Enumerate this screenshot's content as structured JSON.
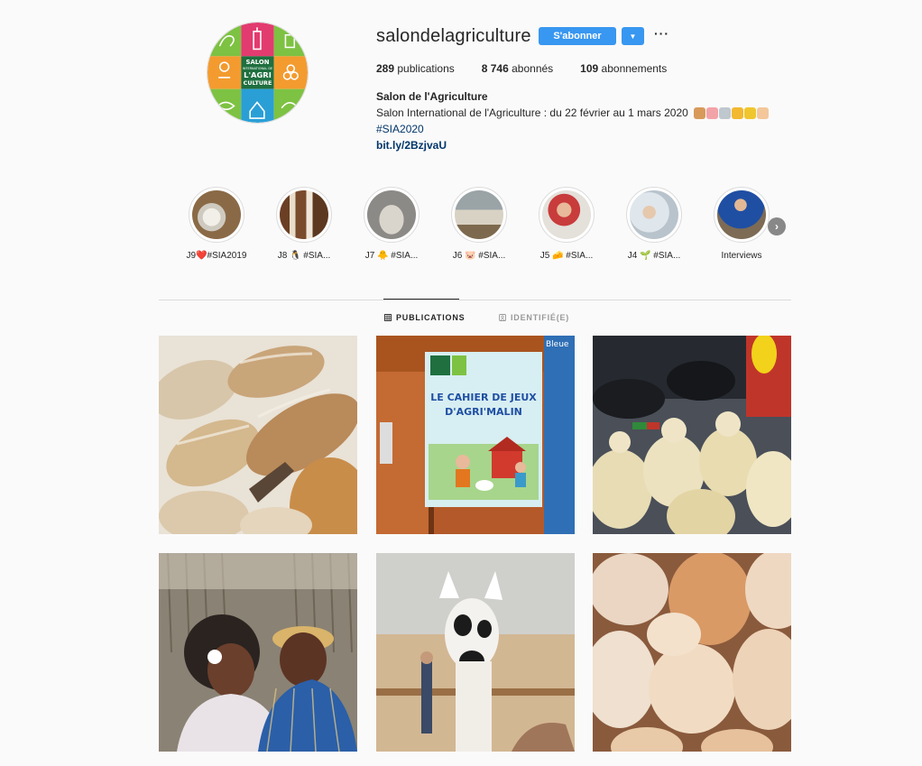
{
  "profile": {
    "username": "salondelagriculture",
    "follow_label": "S'abonner",
    "more_icon": "more-horizontal-icon",
    "stats": {
      "posts": "289",
      "posts_label": "publications",
      "followers": "8 746",
      "followers_label": "abonnés",
      "following": "109",
      "following_label": "abonnements"
    },
    "bio": {
      "name": "Salon de l'Agriculture",
      "line": "Salon International de l'Agriculture : du 22 février au 1 mars 2020",
      "hashtag": "#SIA2020",
      "link": "bit.ly/2BzjvaU"
    },
    "logo_text": [
      "SALON",
      "INTERNATIONAL DE",
      "L'AGRI",
      "CULTURE"
    ]
  },
  "highlights": [
    {
      "label": "J9❤️#SIA2019"
    },
    {
      "label": "J8 🐧 #SIA..."
    },
    {
      "label": "J7 🐥 #SIA..."
    },
    {
      "label": "J6 🐷 #SIA..."
    },
    {
      "label": "J5 🧀 #SIA..."
    },
    {
      "label": "J4 🌱 #SIA..."
    },
    {
      "label": "Interviews"
    }
  ],
  "tabs": [
    {
      "label": "PUBLICATIONS",
      "icon": "grid-icon",
      "active": true
    },
    {
      "label": "IDENTIFIÉ(E)",
      "icon": "tagged-icon",
      "active": false
    }
  ],
  "posts_grid": {
    "rows": 2,
    "columns": 3,
    "posts": [
      {
        "subject": "bread-loaves"
      },
      {
        "subject": "game-booklet",
        "printed_text": [
          "LE CAHIER DE JEUX",
          "D'AGRI'MALIN",
          "Bleue"
        ]
      },
      {
        "subject": "cheeses"
      },
      {
        "subject": "women-smiling"
      },
      {
        "subject": "llama"
      },
      {
        "subject": "eggs"
      }
    ]
  },
  "colors": {
    "follow_button": "#3897f0",
    "link_text": "#003569",
    "background": "#fafafa",
    "border": "#dbdbdb"
  }
}
